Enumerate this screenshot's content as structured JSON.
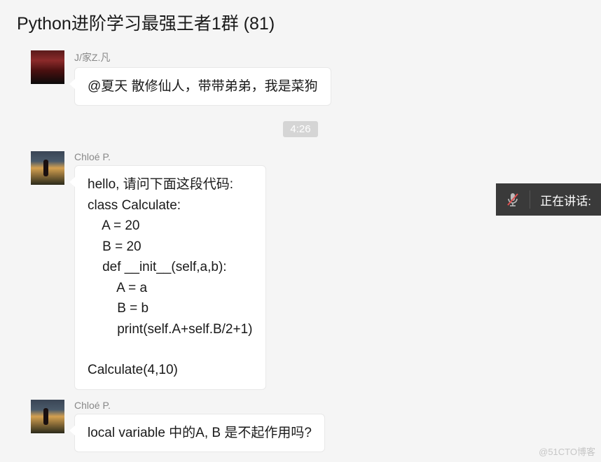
{
  "header": {
    "title": "Python进阶学习最强王者1群 (81)"
  },
  "messages": [
    {
      "sender": "J/家Z.凡",
      "avatar": "sunset1",
      "text": "@夏天 散修仙人，带带弟弟，我是菜狗"
    }
  ],
  "time_badge": "4:26",
  "messages2": [
    {
      "sender": "Chloé P.",
      "avatar": "sunset2",
      "text": "hello, 请问下面这段代码:\nclass Calculate:\n    A = 20\n    B = 20\n    def __init__(self,a,b):\n        A = a\n        B = b\n        print(self.A+self.B/2+1)\n\nCalculate(4,10)"
    },
    {
      "sender": "Chloé P.",
      "avatar": "sunset2",
      "text": "local variable 中的A, B 是不起作用吗?"
    }
  ],
  "voice_strip": {
    "label": "正在讲话:"
  },
  "watermark": "@51CTO博客"
}
